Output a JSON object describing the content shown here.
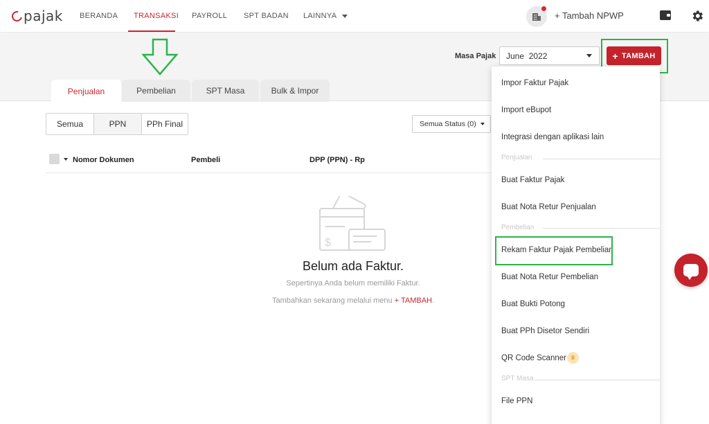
{
  "brand": {
    "logo_text": "pajak",
    "accent": "#c9262f"
  },
  "nav": {
    "items": [
      {
        "label": "BERANDA"
      },
      {
        "label": "TRANSAKSI",
        "active": true
      },
      {
        "label": "PAYROLL"
      },
      {
        "label": "SPT BADAN"
      },
      {
        "label": "LAINNYA"
      }
    ],
    "add_npwp": "+ Tambah NPWP",
    "icons": [
      "company-icon",
      "wallet-icon",
      "gear-icon"
    ]
  },
  "header": {
    "masa_label": "Masa Pajak",
    "masa_value": "June  2022",
    "tambah_label": "TAMBAH"
  },
  "tabs": [
    {
      "label": "Penjualan",
      "active": true
    },
    {
      "label": "Pembelian"
    },
    {
      "label": "SPT Masa"
    },
    {
      "label": "Bulk & Impor"
    }
  ],
  "filters": {
    "segments": [
      {
        "label": "Semua"
      },
      {
        "label": "PPN",
        "active": true
      },
      {
        "label": "PPh Final"
      }
    ],
    "status": "Semua Status (0)"
  },
  "table": {
    "columns": [
      "Nomor Dokumen",
      "Pembeli",
      "DPP (PPN) - Rp"
    ]
  },
  "empty": {
    "title": "Belum ada Faktur.",
    "subtitle": "Sepertinya Anda belum memiliki Faktur.",
    "hint_prefix": "Tambahkan sekarang melalui menu ",
    "hint_link": "+ TAMBAH",
    "hint_suffix": "."
  },
  "menu": {
    "items": [
      {
        "label": "Impor Faktur Pajak"
      },
      {
        "label": "Import eBupot"
      },
      {
        "label": "Integrasi dengan aplikasi lain"
      },
      {
        "label": "Buat Faktur Pajak"
      },
      {
        "label": "Buat Nota Retur Penjualan"
      },
      {
        "label": "Rekam Faktur Pajak Pembelian"
      },
      {
        "label": "Buat Nota Retur Pembelian"
      },
      {
        "label": "Buat Bukti Potong"
      },
      {
        "label": "Buat PPh Disetor Sendiri"
      },
      {
        "label": "QR Code Scanner"
      },
      {
        "label": "File PPN"
      }
    ],
    "headers": [
      "Penjualan",
      "Pembelian",
      "SPT Masa"
    ]
  },
  "colors": {
    "highlight": "#2db34a",
    "button": "#c4232c"
  }
}
